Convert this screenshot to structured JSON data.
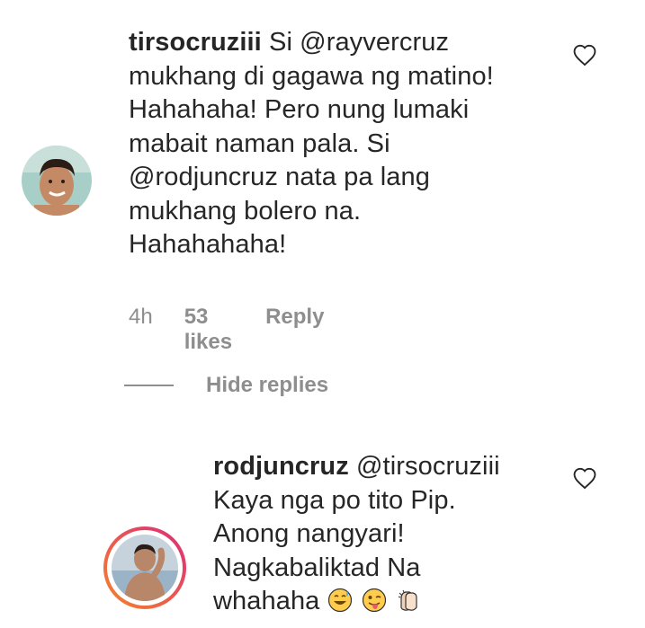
{
  "comment": {
    "username": "tirsocruziii",
    "lines": [
      "Si @rayvercruz",
      "mukhang di gagawa ng matino!",
      "Hahahaha! Pero nung lumaki",
      "mabait naman pala. Si",
      "@rodjuncruz nata pa lang",
      "mukhang bolero na.",
      "Hahahahaha!"
    ],
    "time": "4h",
    "likes": "53 likes",
    "reply_label": "Reply"
  },
  "hide_replies_label": "Hide replies",
  "reply": {
    "username": "rodjuncruz",
    "first_line_text": "@tirsocruziii",
    "lines": [
      "Kaya nga po tito Pip.",
      "Anong nangyari!",
      "Nagkabaliktad Na",
      "whahaha"
    ],
    "emojis": [
      "sweat-smile-emoji",
      "tongue-wink-emoji",
      "clapping-hands-emoji"
    ]
  },
  "colors": {
    "text": "#262626",
    "secondary": "#8e8e8e",
    "story_ring_start": "#f58529",
    "story_ring_end": "#dd2a7b"
  }
}
